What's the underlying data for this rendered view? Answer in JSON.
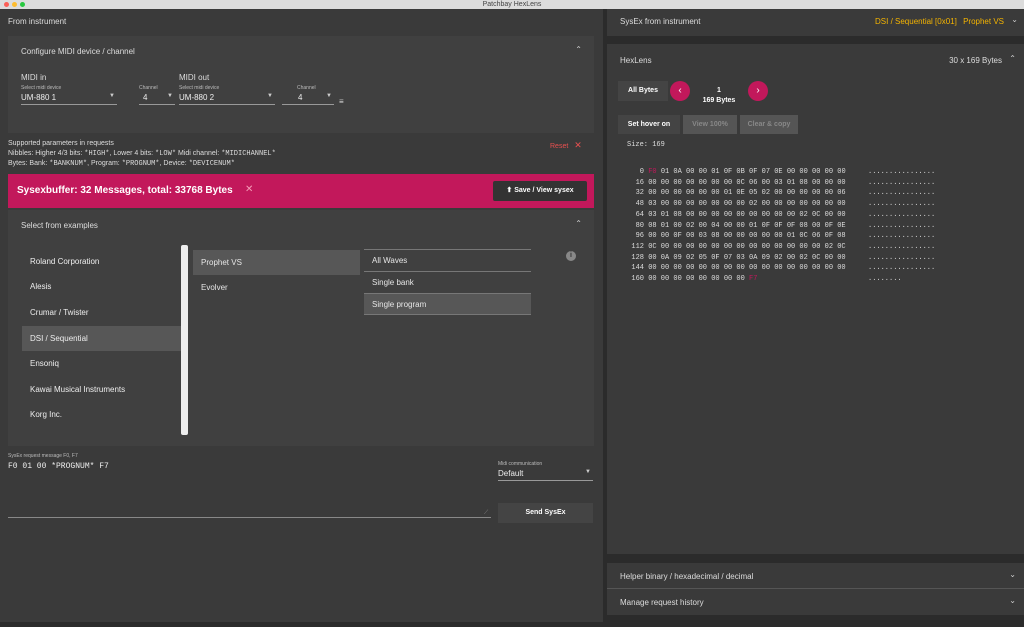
{
  "window": {
    "title": "Patchbay HexLens"
  },
  "left": {
    "header": "From instrument",
    "config": {
      "title": "Configure MIDI device / channel",
      "midi_in_label": "MIDI in",
      "midi_in_device_label": "Select midi device",
      "midi_in_device": "UM-880 1",
      "midi_in_channel_label": "Channel",
      "midi_in_channel": "4",
      "midi_out_label": "MIDI out",
      "midi_out_device_label": "Select midi device",
      "midi_out_device": "UM-880 2",
      "midi_out_channel_label": "Channel",
      "midi_out_channel": "4"
    },
    "params": {
      "title": "Supported parameters in requests",
      "line1_a": "Nibbles: Higher 4/3 bits:",
      "line1_b": "*HIGH*",
      "line1_c": ", Lower 4 bits:",
      "line1_d": "*LOW*",
      "line1_e": "Midi channel:",
      "line1_f": "*MIDICHANNEL*",
      "line2_a": "Bytes: Bank:",
      "line2_b": "*BANKNUM*",
      "line2_c": ", Program:",
      "line2_d": "*PROGNUM*",
      "line2_e": ", Device:",
      "line2_f": "*DEVICENUM*",
      "reset": "Reset"
    },
    "buffer": {
      "text": "Sysexbuffer: 32 Messages, total: 33768 Bytes",
      "save_label": "Save / View sysex"
    },
    "examples": {
      "title": "Select from examples",
      "manufacturers": [
        "Roland Corporation",
        "Alesis",
        "Crumar / Twister",
        "DSI / Sequential",
        "Ensoniq",
        "Kawai Musical Instruments",
        "Korg Inc."
      ],
      "devices": [
        "Prophet VS",
        "Evolver"
      ],
      "requests": [
        "All Waves",
        "Single bank",
        "Single program"
      ]
    },
    "request": {
      "label": "SysEx request message F0, F7",
      "value": "F0 01 00 *PROGNUM* F7",
      "comm_label": "Midi communication",
      "comm_value": "Default",
      "send_label": "Send SysEx"
    }
  },
  "right": {
    "sysex_title": "SysEx from instrument",
    "sysex_source": "DSI / Sequential [0x01]",
    "sysex_device": "Prophet VS",
    "hexlens_title": "HexLens",
    "hexlens_dims": "30 x 169 Bytes",
    "all_bytes": "All Bytes",
    "page_num": "1",
    "page_bytes": "169 Bytes",
    "set_hover": "Set hover on",
    "view100": "View 100%",
    "clear_copy": "Clear & copy",
    "size": "Size: 169",
    "hex_rows": [
      {
        "offset": "0",
        "first": "F0",
        "bytes": "01 0A 00 00 01 0F 0B 0F 07 0E 00 00 00 00 00",
        "ascii": "................"
      },
      {
        "offset": "16",
        "first": "",
        "bytes": "00 00 00 00 00 00 00 0C 06 00 03 01 08 00 00 00",
        "ascii": "................"
      },
      {
        "offset": "32",
        "first": "",
        "bytes": "00 00 00 00 00 00 01 0E 05 02 00 00 00 00 00 06",
        "ascii": "................"
      },
      {
        "offset": "48",
        "first": "",
        "bytes": "03 00 00 00 00 00 00 00 02 00 00 00 00 00 00 00",
        "ascii": "................"
      },
      {
        "offset": "64",
        "first": "",
        "bytes": "03 01 08 00 00 00 00 00 00 00 00 00 02 0C 00 00",
        "ascii": "................"
      },
      {
        "offset": "80",
        "first": "",
        "bytes": "08 01 00 02 00 04 00 00 01 0F 0F 0F 08 00 0F 0E",
        "ascii": "................"
      },
      {
        "offset": "96",
        "first": "",
        "bytes": "00 00 0F 00 03 08 00 00 00 00 00 01 0C 06 0F 08",
        "ascii": "................"
      },
      {
        "offset": "112",
        "first": "",
        "bytes": "0C 00 00 00 00 00 00 00 00 00 00 00 00 00 02 0C",
        "ascii": "................"
      },
      {
        "offset": "128",
        "first": "",
        "bytes": "00 0A 09 02 05 0F 07 03 0A 09 02 00 02 0C 00 00",
        "ascii": "................"
      },
      {
        "offset": "144",
        "first": "",
        "bytes": "00 00 00 00 00 00 00 00 00 00 00 00 00 00 00 00",
        "ascii": "................"
      },
      {
        "offset": "160",
        "first": "",
        "bytes": "00 00 00 00 00 00 00 00 F7",
        "ascii": "........"
      }
    ],
    "helper_title": "Helper binary / hexadecimal / decimal",
    "history_title": "Manage request history"
  },
  "colors": {
    "accent": "#c2185b",
    "source": "#f5b400"
  }
}
